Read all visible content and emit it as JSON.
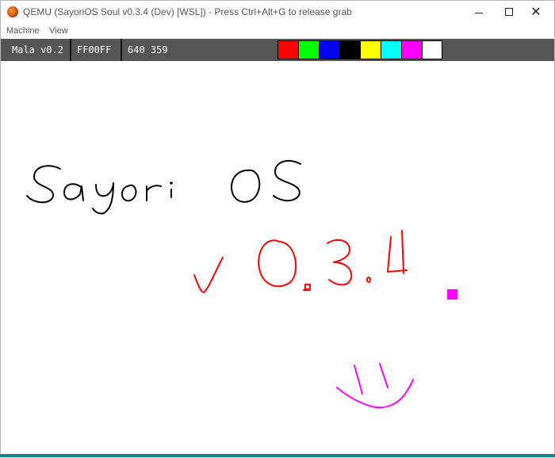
{
  "window": {
    "title": "QEMU (SayoriOS Soul v0.3.4 (Dev) [WSL]) - Press Ctrl+Alt+G to release grab"
  },
  "menu": {
    "items": [
      "Machine",
      "View"
    ]
  },
  "status_bar": {
    "version": "Mala v0.2",
    "current_color": "FF00FF",
    "coordinates": "640 359"
  },
  "palette": {
    "colors": [
      "#ff0000",
      "#00ff00",
      "#0000ff",
      "#000000",
      "#ffff00",
      "#00ffff",
      "#ff00ff",
      "#ffffff"
    ]
  },
  "drawing": {
    "handwritten_text_1": "SayoriOS",
    "handwritten_text_2": "v0.3.4",
    "stroke_colors": {
      "black": "#000000",
      "red": "#ff0000",
      "magenta": "#ff00ff"
    }
  }
}
